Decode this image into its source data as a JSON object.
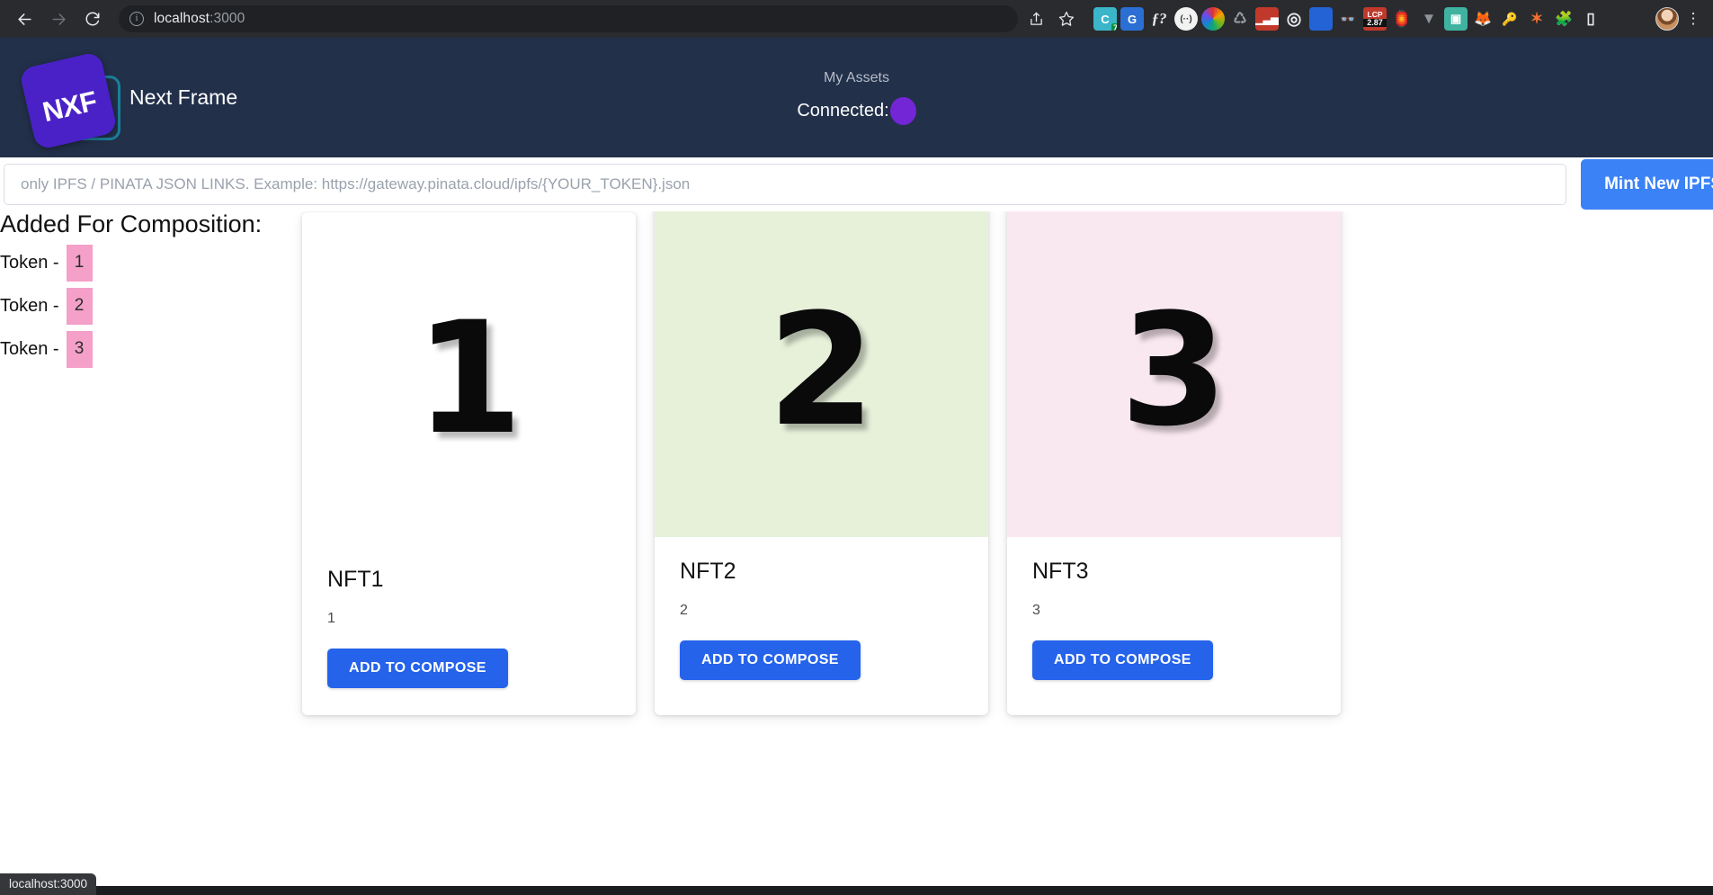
{
  "browser": {
    "back_icon": "back-arrow-icon",
    "forward_icon": "forward-arrow-icon",
    "reload_icon": "reload-icon",
    "site_info_icon": "info-circle-icon",
    "url_host": "localhost",
    "url_port": ":3000",
    "share_icon": "share-icon",
    "bookmark_icon": "star-icon",
    "menu_icon": "kebab-menu-icon",
    "extensions": [
      {
        "name": "colab-extension",
        "glyph": "C",
        "color": "#3bb6c8",
        "badge": "7"
      },
      {
        "name": "google-docs-extension",
        "glyph": "G",
        "color": "#2b6fd4",
        "badge": ""
      },
      {
        "name": "fraction-extension",
        "glyph": "ƒ?",
        "color": "#292b2f",
        "badge": ""
      },
      {
        "name": "wave-extension",
        "glyph": "(··)",
        "color": "#f0f0f0",
        "badge": ""
      },
      {
        "name": "color-wheel-extension",
        "glyph": "",
        "color": "#e04e4e",
        "badge": ""
      },
      {
        "name": "recycle-extension",
        "glyph": "♺",
        "color": "#292b2f",
        "badge": ""
      },
      {
        "name": "analytics-extension",
        "glyph": "▮",
        "color": "#c0392b",
        "badge": ""
      },
      {
        "name": "target-extension",
        "glyph": "◎",
        "color": "#292b2f",
        "badge": ""
      },
      {
        "name": "window-extension",
        "glyph": "",
        "color": "#2463d6",
        "badge": ""
      },
      {
        "name": "glasses-extension",
        "glyph": "👓",
        "color": "#292b2f",
        "badge": ""
      },
      {
        "name": "lcp-extension",
        "glyph": "LCP",
        "color": "#c0392b",
        "badge": "2.87"
      },
      {
        "name": "lighthouse-extension",
        "glyph": "▲",
        "color": "#e8552d",
        "badge": ""
      },
      {
        "name": "vue-devtools-extension",
        "glyph": "V",
        "color": "#8e949c",
        "badge": ""
      },
      {
        "name": "save-extension",
        "glyph": "▣",
        "color": "#3fb2a0",
        "badge": ""
      },
      {
        "name": "metamask-extension",
        "glyph": "🦊",
        "color": "#e2761b",
        "badge": ""
      },
      {
        "name": "password-key-extension",
        "glyph": "🔑",
        "color": "#2ea3a3",
        "badge": ""
      },
      {
        "name": "spark-extension",
        "glyph": "✶",
        "color": "#f07030",
        "badge": ""
      },
      {
        "name": "extensions-puzzle",
        "glyph": "🧩",
        "color": "#292b2f",
        "badge": ""
      },
      {
        "name": "sidepanel-extension",
        "glyph": "▯",
        "color": "#292b2f",
        "badge": ""
      }
    ]
  },
  "header": {
    "logo_text": "NXF",
    "logo_icon": "nxf-logo-icon",
    "brand_title": "Next Frame",
    "my_assets_label": "My Assets",
    "connected_label": "Connected:",
    "wallet_avatar_icon": "wallet-avatar-icon",
    "accent_purple": "#4a21c7",
    "header_bg": "#22304a"
  },
  "mint": {
    "input_value": "",
    "input_placeholder": "only IPFS / PINATA JSON LINKS. Example: https://gateway.pinata.cloud/ipfs/{YOUR_TOKEN}.json",
    "button_label": "Mint New IPFS",
    "button_color": "#3b82f6"
  },
  "compose": {
    "title": "Added For Composition:",
    "tokens": [
      {
        "label": "Token -",
        "id": "1"
      },
      {
        "label": "Token -",
        "id": "2"
      },
      {
        "label": "Token -",
        "id": "3"
      }
    ],
    "badge_color": "#f4a0c8"
  },
  "cards": [
    {
      "title": "NFT1",
      "description": "1",
      "button_label": "ADD TO COMPOSE",
      "media_glyph": "1",
      "media_bg": "#ffffff",
      "media_icon": "nft-image-1"
    },
    {
      "title": "NFT2",
      "description": "2",
      "button_label": "ADD TO COMPOSE",
      "media_glyph": "2",
      "media_bg": "#e7f1da",
      "media_icon": "nft-image-2"
    },
    {
      "title": "NFT3",
      "description": "3",
      "button_label": "ADD TO COMPOSE",
      "media_glyph": "3",
      "media_bg": "#fae8f0",
      "media_icon": "nft-image-3"
    }
  ],
  "status_bar": {
    "text": "localhost:3000"
  }
}
